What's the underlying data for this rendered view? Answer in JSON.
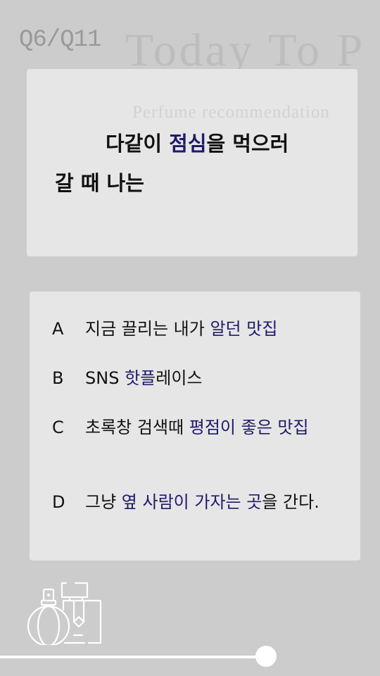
{
  "header": {
    "question_counter": "Q6/Q11",
    "bg_title": "Today To P",
    "bg_subtitle": "Perfume recommendation"
  },
  "question": {
    "line1": [
      {
        "t": "다같이 ",
        "hl": false
      },
      {
        "t": "점심",
        "hl": true
      },
      {
        "t": "을 먹으러",
        "hl": false
      }
    ],
    "line2": "갈 때 나는"
  },
  "options": [
    {
      "letter": "A",
      "parts": [
        {
          "t": "지금 끌리는 내가 ",
          "hl": false
        },
        {
          "t": "알던 맛집",
          "hl": true
        }
      ]
    },
    {
      "letter": "B",
      "parts": [
        {
          "t": "SNS ",
          "hl": false
        },
        {
          "t": "핫플",
          "hl": true
        },
        {
          "t": "레이스",
          "hl": false
        }
      ]
    },
    {
      "letter": "C",
      "parts": [
        {
          "t": "초록창 검색때 ",
          "hl": false
        },
        {
          "t": "평점이 좋은 맛집",
          "hl": true
        }
      ]
    },
    {
      "letter": "D",
      "parts": [
        {
          "t": "그냥 ",
          "hl": false
        },
        {
          "t": "옆 사람이 가자는 곳",
          "hl": true
        },
        {
          "t": "을 간다.",
          "hl": false
        }
      ]
    }
  ],
  "progress": {
    "fraction": 0.7
  },
  "colors": {
    "accent": "#1f1a6b",
    "background": "#cccccc",
    "card": "#e6e6e6"
  }
}
